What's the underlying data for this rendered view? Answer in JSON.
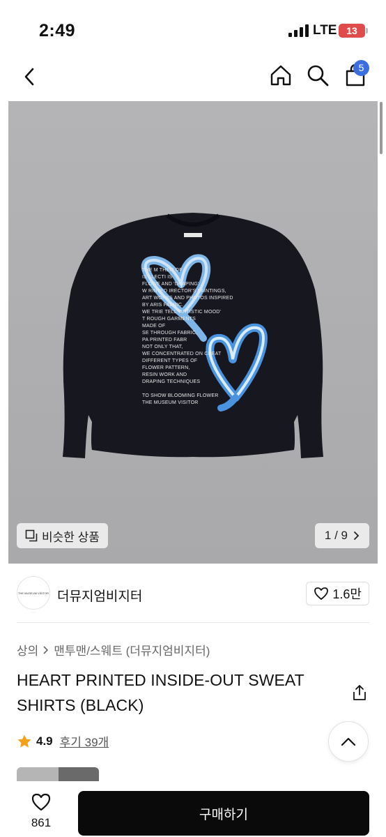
{
  "status_bar": {
    "time": "2:49",
    "network": "LTE",
    "battery": "13",
    "battery_color": "#e04b4b"
  },
  "header": {
    "back_icon": "chevron-left-icon",
    "home_icon": "home-icon",
    "search_icon": "search-icon",
    "cart_icon": "shopping-bag-icon",
    "cart_badge": "5",
    "badge_color": "#3b6fe0"
  },
  "gallery": {
    "similar_label": "비슷한 상품",
    "page_current": "1",
    "page_total": "9",
    "page_text": "1 / 9",
    "print_text": [
      "THE M        THEM  OF",
      "IS   LLECTI    IS",
      "FLOWE  AND 'DRAPING'.",
      "W  RINTED  IRECTOR'S PAINTINGS,",
      "ART WORKS   AND PHOTOS INSPIRED",
      "BY  ARIS   FABRIC.",
      "WE TRIE    TELL 'ARTISTIC MOOD'",
      "T  ROUGH GARMENTS",
      "MADE OF",
      "SE  THROUGH FABRIC,",
      "PA   PRINTED FABR",
      "NOT ONLY THAT,",
      "WE CONCENTRATED ON CREAT",
      "DIFFERENT TYPES OF",
      "FLOWER PATTERN,",
      "RESIN WORK AND",
      "DRAPING TECHNIQUES",
      "",
      "TO SHOW BLOOMING FLOWER",
      "THE MUSEUM VISITOR"
    ],
    "neck_label": "THE MUSEUM VISITOR"
  },
  "brand": {
    "logo_text": "THE MUSEUM VISITOR",
    "name": "더뮤지엄비지터",
    "likes": "1.6만"
  },
  "breadcrumb": {
    "category": "상의",
    "separator": ">",
    "sub": "맨투맨/스웨트 (더뮤지엄비지터)"
  },
  "product": {
    "title": "HEART PRINTED INSIDE-OUT SWEAT SHIRTS (BLACK)",
    "rating": "4.9",
    "reviews": "후기 39개",
    "star_color": "#f3a01b"
  },
  "bottom": {
    "wish_count": "861",
    "buy_label": "구매하기"
  }
}
